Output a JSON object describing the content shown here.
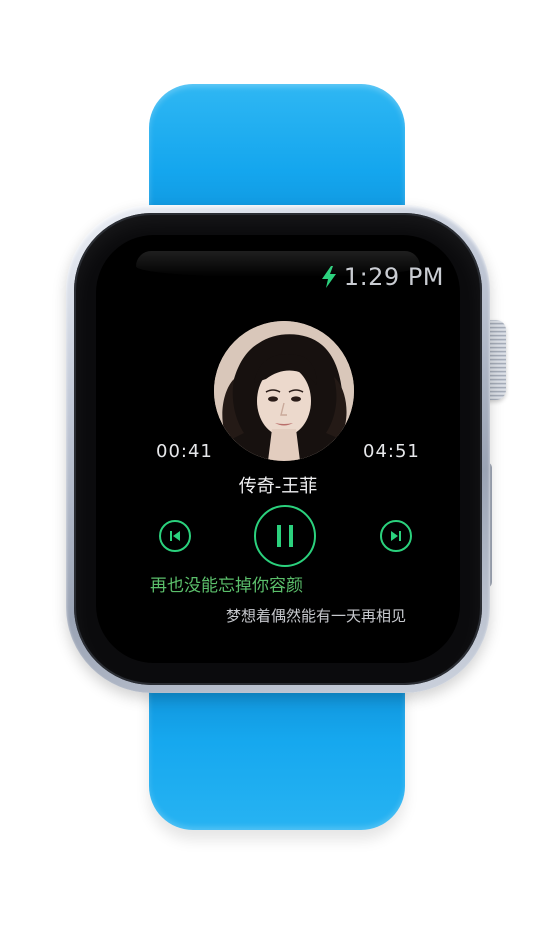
{
  "status": {
    "time": "1:29 PM",
    "charging_icon": "bolt-icon",
    "accent_color": "#2bd17d"
  },
  "player": {
    "elapsed": "00:41",
    "total": "04:51",
    "title": "传奇-王菲",
    "state": "playing",
    "controls": {
      "previous_icon": "skip-previous-icon",
      "play_pause_icon": "pause-icon",
      "next_icon": "skip-next-icon"
    }
  },
  "lyrics": {
    "current": "再也没能忘掉你容颜",
    "next": "梦想着偶然能有一天再相见",
    "current_color": "#5bbf6b"
  },
  "band_color": "#14a6ee"
}
